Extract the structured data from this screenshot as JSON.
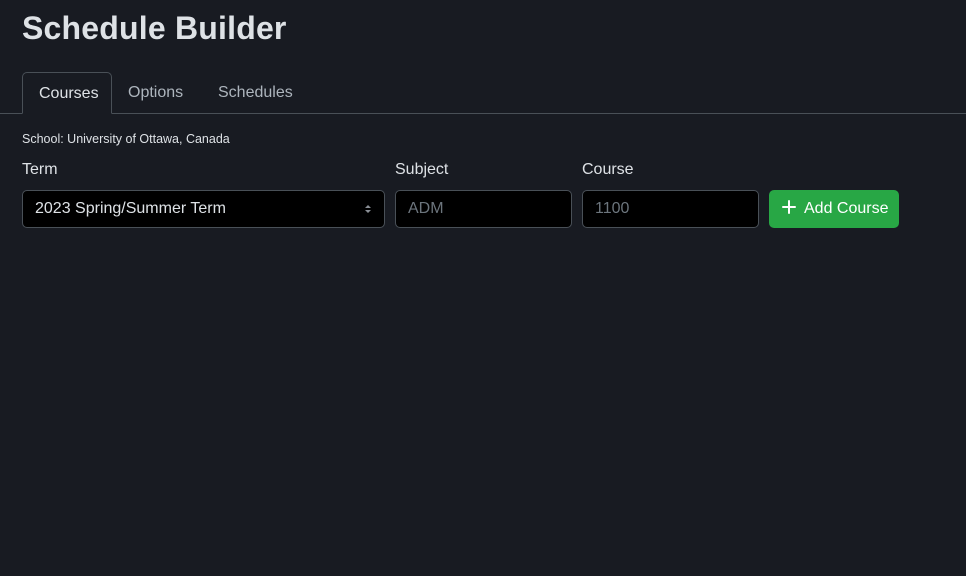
{
  "app": {
    "title": "Schedule Builder"
  },
  "tabs": [
    {
      "label": "Courses",
      "active": true
    },
    {
      "label": "Options",
      "active": false
    },
    {
      "label": "Schedules",
      "active": false
    }
  ],
  "school": {
    "text": "School: University of Ottawa, Canada"
  },
  "form": {
    "term_label": "Term",
    "term_value": "2023 Spring/Summer Term",
    "subject_label": "Subject",
    "subject_placeholder": "ADM",
    "subject_value": "",
    "course_label": "Course",
    "course_placeholder": "1100",
    "course_value": "",
    "add_button_label": "Add Course",
    "add_button_icon": "plus-icon"
  },
  "colors": {
    "background": "#181b22",
    "accent_green": "#28a745",
    "input_background": "#000000",
    "border": "#495057"
  }
}
